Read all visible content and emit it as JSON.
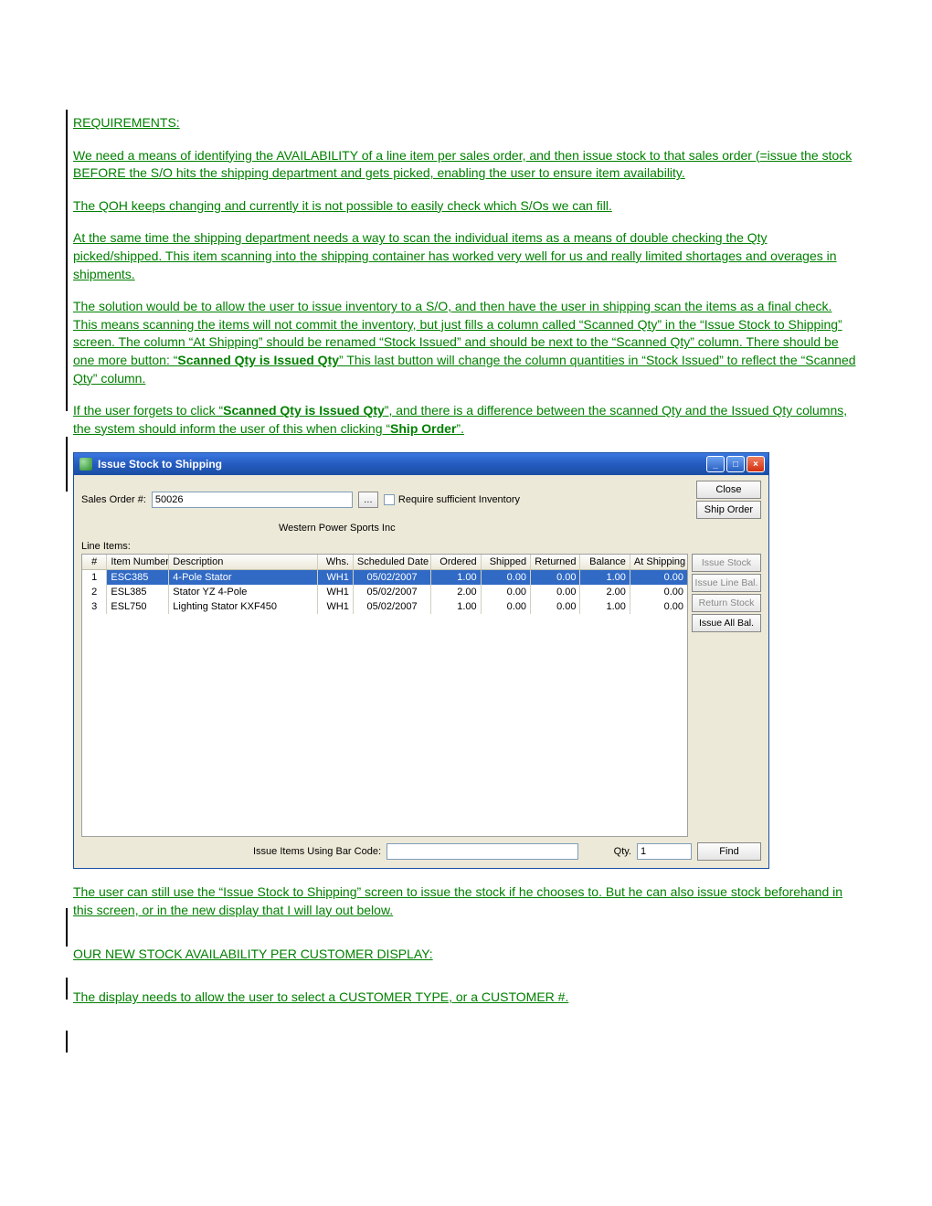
{
  "doc": {
    "heading": "REQUIREMENTS:",
    "p1": "We need a means of identifying the AVAILABILITY of a line item per sales order, and then issue stock to that sales order (=issue the stock BEFORE the S/O hits the shipping department and gets picked, enabling the user to ensure item availability.",
    "p2": "The QOH keeps changing and currently it is not possible to easily check which S/Os we can fill.",
    "p3": "At the same time the shipping department needs a way to scan the individual items as a means of double checking the Qty picked/shipped. This item scanning into the shipping container has worked very well for us and really limited shortages and overages in shipments.",
    "p4a": "The solution would be to allow the user to issue inventory to a S/O, and then have the user in shipping scan the items as a final check. This means scanning the items will not commit the inventory, but just fills a column called “Scanned Qty” in the “Issue Stock to Shipping” screen. The column “At Shipping” should be renamed “Stock Issued” and should be next to the “Scanned Qty” column. There should be one more button:  “",
    "p4b": "Scanned Qty is Issued Qty",
    "p4c": "” This last button will change the column quantities in “Stock Issued” to reflect the “Scanned Qty” column.",
    "p5a": "If the user forgets to click “",
    "p5b": "Scanned Qty is Issued Qty",
    "p5c": "”, and there is a difference between the scanned Qty and the Issued Qty columns, the system should inform the user of this when clicking “",
    "p5d": "Ship Order",
    "p5e": "”.",
    "p6": "The user can still use the “Issue Stock to Shipping” screen to issue the stock if he chooses to. But he can also issue stock beforehand in this screen, or in the new display that I will lay out below.",
    "p7": "OUR NEW STOCK AVAILABILITY PER CUSTOMER DISPLAY:",
    "p8": "The display needs to allow the user to select a CUSTOMER TYPE, or a CUSTOMER #."
  },
  "win": {
    "title": "Issue Stock to Shipping",
    "so_label": "Sales Order #:",
    "so_value": "50026",
    "req_inv": "Require sufficient Inventory",
    "close": "Close",
    "ship_order": "Ship Order",
    "customer": "Western Power Sports Inc",
    "line_items_label": "Line Items:",
    "columns": {
      "num": "#",
      "item": "Item Number",
      "desc": "Description",
      "whs": "Whs.",
      "date": "Scheduled Date",
      "ordered": "Ordered",
      "shipped": "Shipped",
      "returned": "Returned",
      "balance": "Balance",
      "atship": "At Shipping"
    },
    "rows": [
      {
        "num": "1",
        "item": "ESC385",
        "desc": "4-Pole Stator",
        "whs": "WH1",
        "date": "05/02/2007",
        "ordered": "1.00",
        "shipped": "0.00",
        "returned": "0.00",
        "balance": "1.00",
        "atship": "0.00"
      },
      {
        "num": "2",
        "item": "ESL385",
        "desc": "Stator YZ 4-Pole",
        "whs": "WH1",
        "date": "05/02/2007",
        "ordered": "2.00",
        "shipped": "0.00",
        "returned": "0.00",
        "balance": "2.00",
        "atship": "0.00"
      },
      {
        "num": "3",
        "item": "ESL750",
        "desc": "Lighting Stator KXF450",
        "whs": "WH1",
        "date": "05/02/2007",
        "ordered": "1.00",
        "shipped": "0.00",
        "returned": "0.00",
        "balance": "1.00",
        "atship": "0.00"
      }
    ],
    "side": {
      "issue_stock": "Issue Stock",
      "issue_line_bal": "Issue Line Bal.",
      "return_stock": "Return Stock",
      "issue_all_bal": "Issue All Bal."
    },
    "barcode_label": "Issue Items Using Bar Code:",
    "qty_label": "Qty.",
    "qty_value": "1",
    "find": "Find"
  }
}
